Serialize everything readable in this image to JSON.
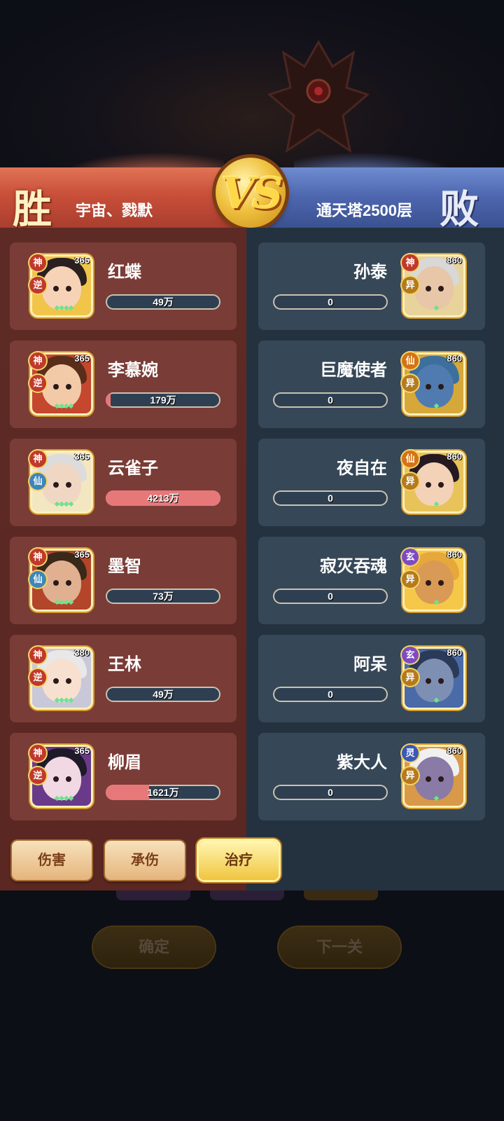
{
  "banner": {
    "win_label": "胜",
    "lose_label": "败",
    "vs_label": "VS",
    "left_team": "宇宙、戮默",
    "right_team": "通天塔2500层"
  },
  "left_heroes": [
    {
      "name": "红蝶",
      "level": "365",
      "tag1": "神",
      "tag2": "逆",
      "value": "49万",
      "fill": 0.0
    },
    {
      "name": "李慕婉",
      "level": "365",
      "tag1": "神",
      "tag2": "逆",
      "value": "179万",
      "fill": 0.04
    },
    {
      "name": "云雀子",
      "level": "365",
      "tag1": "神",
      "tag2": "仙",
      "value": "4213万",
      "fill": 1.0
    },
    {
      "name": "墨智",
      "level": "365",
      "tag1": "神",
      "tag2": "仙",
      "value": "73万",
      "fill": 0.0
    },
    {
      "name": "王林",
      "level": "380",
      "tag1": "神",
      "tag2": "逆",
      "value": "49万",
      "fill": 0.0
    },
    {
      "name": "柳眉",
      "level": "365",
      "tag1": "神",
      "tag2": "逆",
      "value": "1621万",
      "fill": 0.38
    }
  ],
  "right_heroes": [
    {
      "name": "孙泰",
      "level": "860",
      "tag1": "神",
      "tag2": "异",
      "value": "0",
      "fill": 0.0
    },
    {
      "name": "巨魔使者",
      "level": "860",
      "tag1": "仙",
      "tag2": "异",
      "value": "0",
      "fill": 0.0
    },
    {
      "name": "夜自在",
      "level": "860",
      "tag1": "仙",
      "tag2": "异",
      "value": "0",
      "fill": 0.0
    },
    {
      "name": "寂灭吞魂",
      "level": "860",
      "tag1": "玄",
      "tag2": "异",
      "value": "0",
      "fill": 0.0
    },
    {
      "name": "阿呆",
      "level": "860",
      "tag1": "玄",
      "tag2": "异",
      "value": "0",
      "fill": 0.0
    },
    {
      "name": "紫大人",
      "level": "860",
      "tag1": "灵",
      "tag2": "异",
      "value": "0",
      "fill": 0.0
    }
  ],
  "tabs": {
    "damage": "伤害",
    "taken": "承伤",
    "heal": "治疗",
    "active": "heal"
  },
  "background_buttons": {
    "confirm": "确定",
    "next": "下一关"
  },
  "colors": {
    "left_panel": "#5e2a25",
    "right_panel": "#243240",
    "bar_fill": "#e7787a",
    "accent_gold": "#f0c540"
  }
}
